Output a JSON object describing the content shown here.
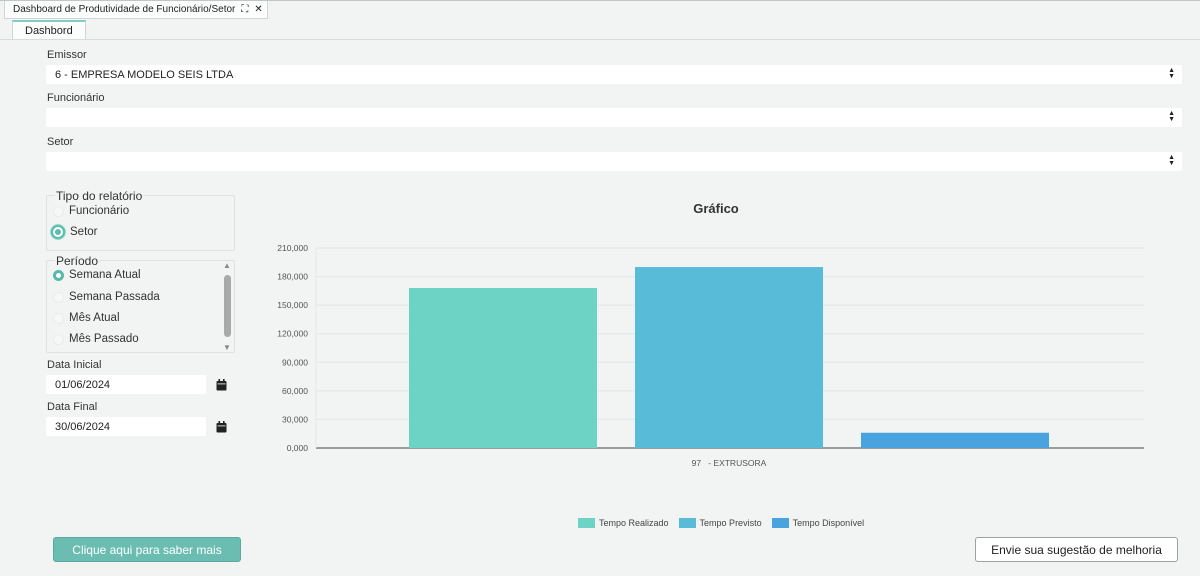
{
  "window": {
    "tab_title": "Dashboard de Produtividade de Funcionário/Setor"
  },
  "inner_tab": {
    "label": "Dashbord"
  },
  "form": {
    "emissor_label": "Emissor",
    "emissor_value": "6 - EMPRESA MODELO SEIS LTDA",
    "funcionario_label": "Funcionário",
    "funcionario_value": "",
    "setor_label": "Setor",
    "setor_value": ""
  },
  "report_type": {
    "title": "Tipo do relatório",
    "options": [
      {
        "label": "Funcionário",
        "checked": false
      },
      {
        "label": "Setor",
        "checked": true
      }
    ]
  },
  "period": {
    "title": "Período",
    "options": [
      {
        "label": "Semana Atual",
        "checked": true
      },
      {
        "label": "Semana Passada",
        "checked": false
      },
      {
        "label": "Mês Atual",
        "checked": false
      },
      {
        "label": "Mês Passado",
        "checked": false
      }
    ]
  },
  "dates": {
    "start_label": "Data Inicial",
    "start_value": "01/06/2024",
    "end_label": "Data Final",
    "end_value": "30/06/2024"
  },
  "buttons": {
    "info_label": "Clique aqui para saber mais",
    "suggest_label": "Envie sua sugestão de melhoria"
  },
  "chart_data": {
    "type": "bar",
    "title": "Gráfico",
    "categories": [
      "97   - EXTRUSORA"
    ],
    "series": [
      {
        "name": "Tempo Realizado",
        "values": [
          168000
        ],
        "color": "#6dd3c4"
      },
      {
        "name": "Tempo Previsto",
        "values": [
          190000
        ],
        "color": "#58bcd8"
      },
      {
        "name": "Tempo Disponível",
        "values": [
          16000
        ],
        "color": "#48a3df"
      }
    ],
    "ylim": [
      0,
      210000
    ],
    "y_ticks": [
      "0,000",
      "30,000",
      "60,000",
      "90,000",
      "120,000",
      "150,000",
      "180,000",
      "210,000"
    ],
    "grid": true,
    "legend_position": "bottom"
  }
}
